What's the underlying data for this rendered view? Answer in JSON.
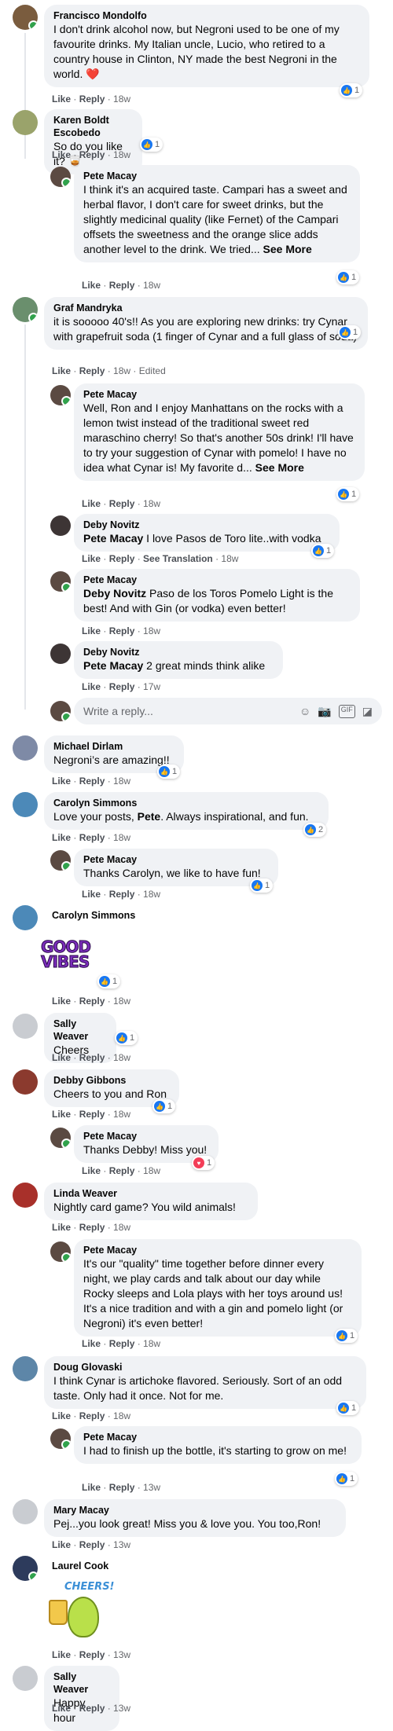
{
  "colors": {
    "link": "#1877f2",
    "muted": "#65676b",
    "bubble": "#f0f2f5",
    "online": "#31a24c"
  },
  "labels": {
    "like": "Like",
    "reply": "Reply",
    "see_more": "See More",
    "see_translation": "See Translation",
    "edited": "Edited"
  },
  "comments": [
    {
      "name": "Francisco Mondolfo",
      "text": "I don't drink alcohol now, but Negroni used to be one of my favourite drinks. My Italian uncle, Lucio, who retired to a country house in Clinton, NY made the best Negroni in the world. ❤️",
      "time": "18w",
      "reactions": "1"
    },
    {
      "name": "Karen Boldt Escobedo",
      "text": "So do you like it? 🥃",
      "time": "18w",
      "reactions": "1"
    },
    {
      "name": "Pete Macay",
      "text": "I think it's an acquired taste. Campari has a sweet and herbal flavor, I don't care for sweet drinks, but the slightly medicinal quality (like Fernet) of the Campari offsets the sweetness and the orange slice adds another level to the drink. We tried...",
      "time": "18w",
      "reactions": "1"
    },
    {
      "name": "Graf Mandryka",
      "text": "it is sooooo 40's!! As you are exploring new drinks: try Cynar with grapefruit soda (1 finger of Cynar and a full glass of soda)",
      "time": "18w",
      "reactions": "1"
    },
    {
      "name": "Pete Macay",
      "text": "Well, Ron and I enjoy Manhattans on the rocks with a lemon twist instead of the traditional sweet red maraschino cherry! So that's another 50s drink! I'll have to try your suggestion of Cynar with pomelo! I have no idea what Cynar is! My favorite d...",
      "time": "18w",
      "reactions": "1"
    },
    {
      "name": "Deby Novitz",
      "tag": "Pete Macay",
      "text": " I love Pasos de Toro lite..with vodka",
      "time": "18w",
      "reactions": "1"
    },
    {
      "name": "Pete Macay",
      "tag": "Deby Novitz",
      "text": " Paso de los Toros Pomelo Light is the best! And with Gin (or vodka) even better!",
      "time": "18w"
    },
    {
      "name": "Deby Novitz",
      "tag": "Pete Macay",
      "text": " 2 great minds think alike",
      "time": "17w"
    },
    {
      "name": "Michael Dirlam",
      "text": "Negroni’s are amazing!!",
      "time": "18w",
      "reactions": "1"
    },
    {
      "name": "Carolyn Simmons",
      "text_a": "Love your posts, ",
      "text_b": "Pete",
      "text_c": ". Always inspirational, and fun.",
      "time": "18w",
      "reactions": "2"
    },
    {
      "name": "Pete Macay",
      "text": "Thanks Carolyn, we like to have fun!",
      "time": "18w",
      "reactions": "1"
    },
    {
      "name": "Carolyn Simmons",
      "sticker_text": "GOOD VIBES",
      "time": "18w",
      "reactions": "1"
    },
    {
      "name": "Sally Weaver",
      "text": "Cheers",
      "time": "18w",
      "reactions": "1"
    },
    {
      "name": "Debby Gibbons",
      "text": "Cheers to you and Ron",
      "time": "18w",
      "reactions": "1"
    },
    {
      "name": "Pete Macay",
      "text": "Thanks Debby! Miss you!",
      "time": "18w",
      "reactions": "1"
    },
    {
      "name": "Linda Weaver",
      "text": "Nightly card game? You wild animals!",
      "time": "18w"
    },
    {
      "name": "Pete Macay",
      "text": "It's our \"quality\" time together before dinner every night, we play cards and talk about our day while Rocky sleeps and Lola plays with her toys around us! It's a nice tradition and with a gin and pomelo light (or Negroni) it's even better!",
      "time": "18w",
      "reactions": "1"
    },
    {
      "name": "Doug Glovaski",
      "text": "I think Cynar is artichoke flavored. Seriously. Sort of an odd taste. Only had it once. Not for me.",
      "time": "18w",
      "reactions": "1"
    },
    {
      "name": "Pete Macay",
      "text": "I had to finish up the bottle, it's starting to grow on me!",
      "time": "13w",
      "reactions": "1"
    },
    {
      "name": "Mary Macay",
      "text": "Pej...you look great! Miss you & love you. You too,Ron!",
      "time": "13w"
    },
    {
      "name": "Laurel Cook",
      "sticker_text": "CHEERS!",
      "time": "13w"
    },
    {
      "name": "Sally Weaver",
      "text": "Happy hour",
      "time": "13w"
    }
  ],
  "write_reply": {
    "placeholder": "Write a reply..."
  },
  "icons": [
    "emoji-icon",
    "camera-icon",
    "gif-icon",
    "sticker-icon"
  ]
}
